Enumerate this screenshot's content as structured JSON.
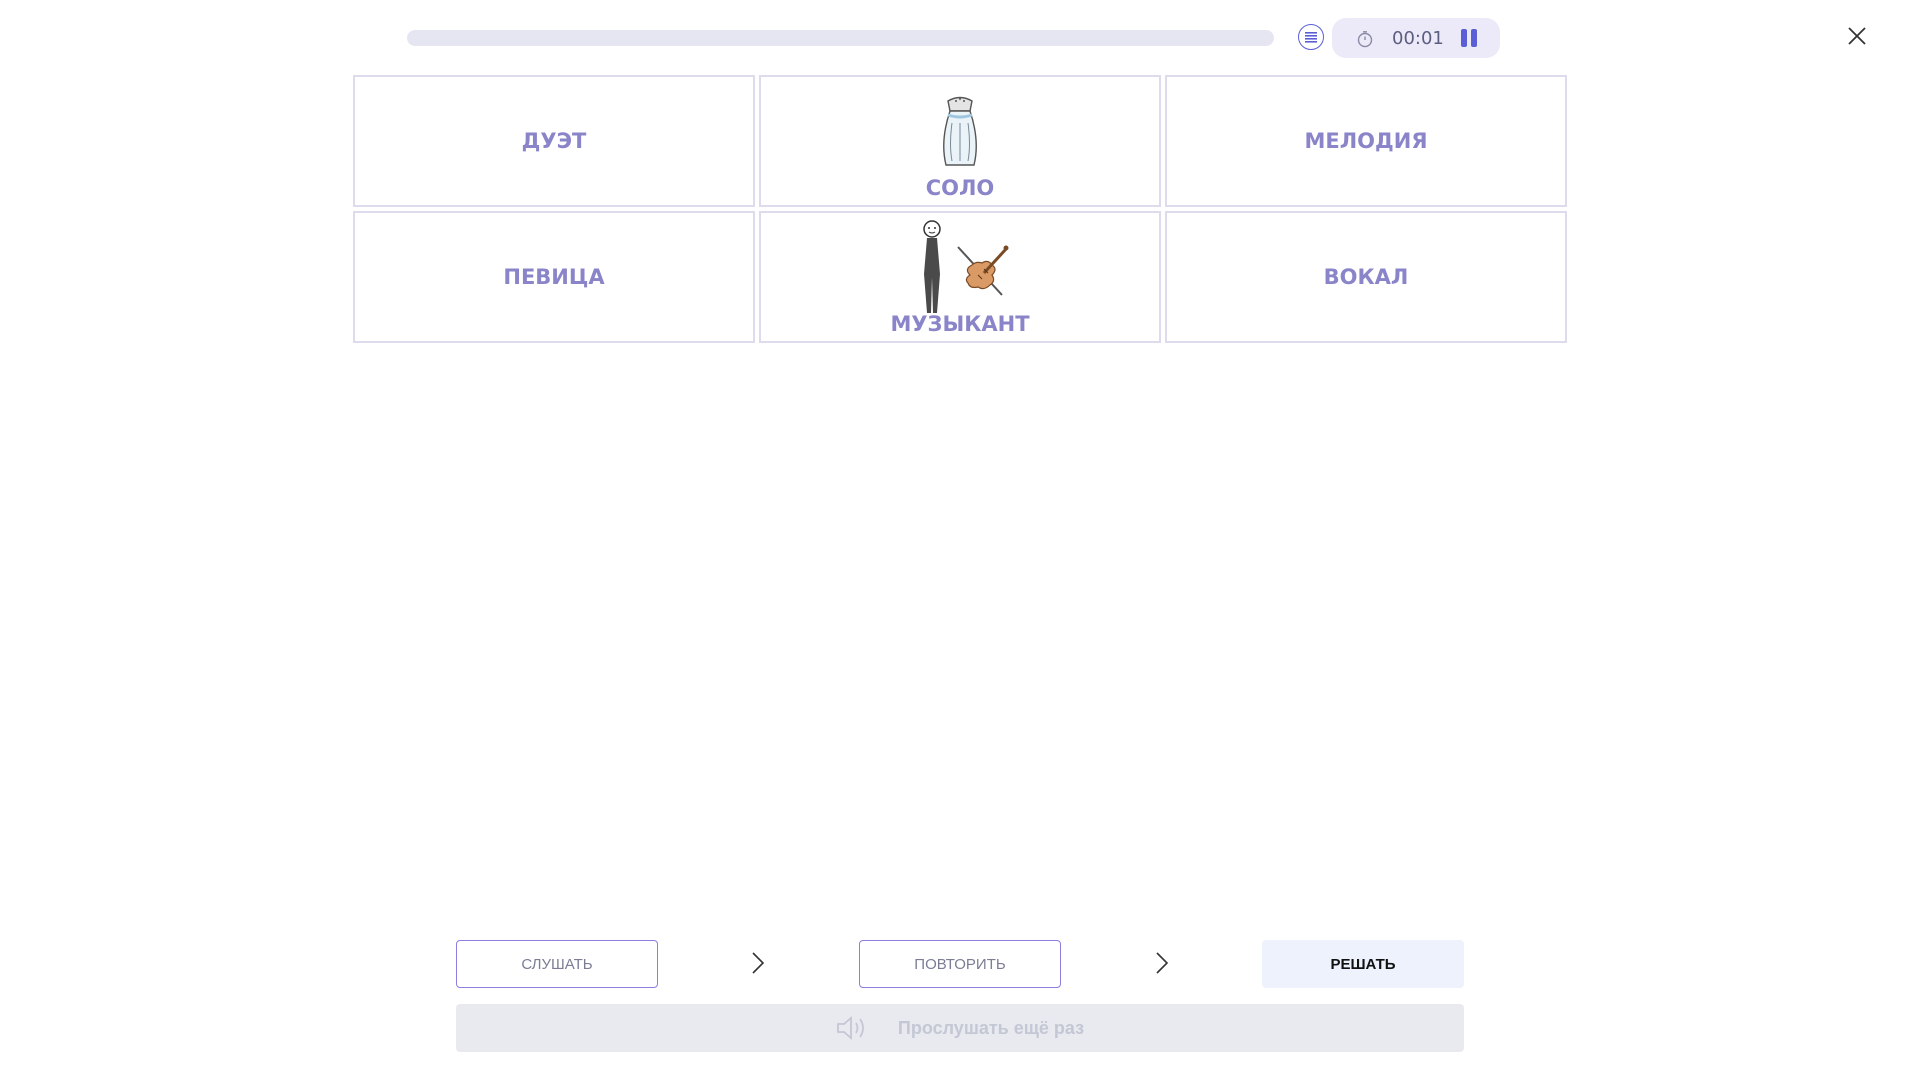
{
  "header": {
    "progress_fraction": 0,
    "timer": "00:01",
    "icons": {
      "list": "list-icon",
      "timer": "stopwatch-icon",
      "pause": "pause-icon",
      "close": "close-icon"
    }
  },
  "cards": [
    {
      "label": "ДУЭТ",
      "picture": null
    },
    {
      "label": "СОЛО",
      "picture": "salt-shaker-icon"
    },
    {
      "label": "МЕЛОДИЯ",
      "picture": null
    },
    {
      "label": "ПЕВИЦА",
      "picture": null
    },
    {
      "label": "МУЗЫКАНТ",
      "picture": "violinist-icon"
    },
    {
      "label": "ВОКАЛ",
      "picture": null
    }
  ],
  "steps": {
    "listen": "СЛУШАТЬ",
    "repeat": "ПОВТОРИТЬ",
    "solve": "РЕШАТЬ"
  },
  "replay": {
    "label": "Прослушать ещё раз",
    "icon": "speaker-icon"
  },
  "colors": {
    "accent": "#5a5fd6",
    "card_text": "#8a85c9",
    "card_border": "#dcdcec"
  }
}
